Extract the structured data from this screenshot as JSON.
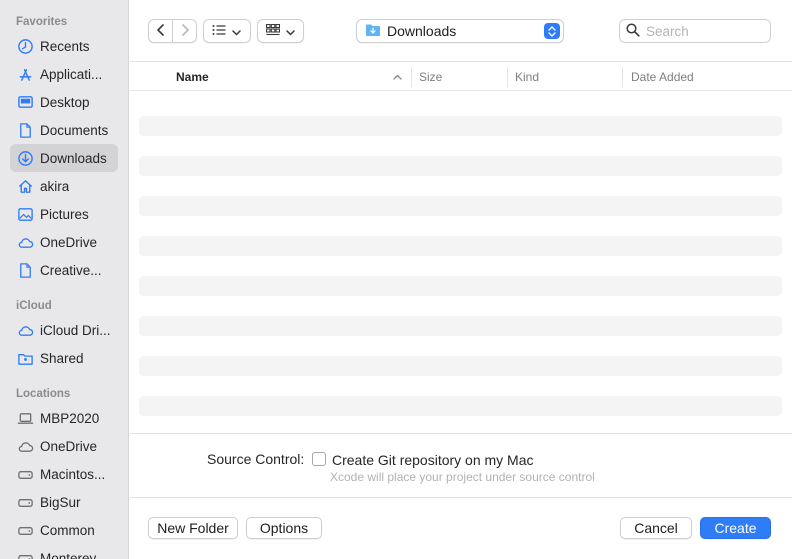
{
  "sidebar": {
    "sections": [
      {
        "title": "Favorites"
      },
      {
        "title": "iCloud"
      },
      {
        "title": "Locations"
      }
    ],
    "favorites": [
      {
        "label": "Recents",
        "icon": "clock-icon"
      },
      {
        "label": "Applicati...",
        "icon": "applications-icon"
      },
      {
        "label": "Desktop",
        "icon": "desktop-icon"
      },
      {
        "label": "Documents",
        "icon": "document-icon"
      },
      {
        "label": "Downloads",
        "icon": "download-icon",
        "selected": true
      },
      {
        "label": "akira",
        "icon": "home-icon"
      },
      {
        "label": "Pictures",
        "icon": "pictures-icon"
      },
      {
        "label": "OneDrive",
        "icon": "cloud-icon"
      },
      {
        "label": "Creative...",
        "icon": "document-icon"
      }
    ],
    "icloud": [
      {
        "label": "iCloud Dri...",
        "icon": "cloud-icon"
      },
      {
        "label": "Shared",
        "icon": "shared-folder-icon"
      }
    ],
    "locations": [
      {
        "label": "MBP2020",
        "icon": "laptop-icon"
      },
      {
        "label": "OneDrive",
        "icon": "cloud-icon"
      },
      {
        "label": "Macintos...",
        "icon": "disk-icon"
      },
      {
        "label": "BigSur",
        "icon": "disk-icon"
      },
      {
        "label": "Common",
        "icon": "disk-icon"
      },
      {
        "label": "Monterey",
        "icon": "disk-icon"
      }
    ]
  },
  "toolbar": {
    "back_icon": "chevron-left-icon",
    "forward_icon": "chevron-right-icon",
    "list_view_icon": "list-view-icon",
    "grid_view_icon": "grid-view-icon",
    "path": {
      "label": "Downloads",
      "icon": "folder-icon"
    },
    "search": {
      "placeholder": "Search",
      "value": ""
    }
  },
  "columns": {
    "name": "Name",
    "size": "Size",
    "kind": "Kind",
    "date_added": "Date Added",
    "sort_indicator": "chevron-up-icon"
  },
  "file_rows": [],
  "accessory": {
    "source_control_label": "Source Control:",
    "checkbox_label": "Create Git repository on my Mac",
    "checkbox_checked": false,
    "hint": "Xcode will place your project under source control"
  },
  "buttons": {
    "new_folder": "New Folder",
    "options": "Options",
    "cancel": "Cancel",
    "create": "Create"
  },
  "colors": {
    "accent": "#2f7df6",
    "sidebar_bg": "#e8e8ea",
    "selected_bg": "#d3d3d6",
    "icon_blue": "#2f7cf6"
  }
}
